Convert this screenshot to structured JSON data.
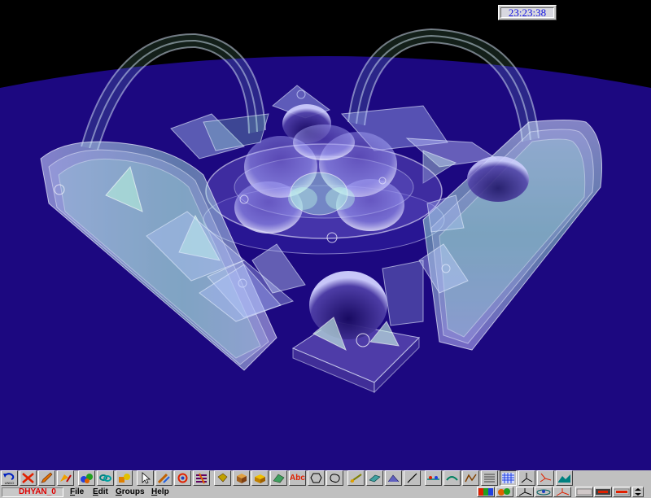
{
  "app": {
    "document_name": "DHYAN_0",
    "clock": "23:23:38"
  },
  "menu": [
    {
      "label": "File",
      "hotkey": "F",
      "rest": "ile"
    },
    {
      "label": "Edit",
      "hotkey": "E",
      "rest": "dit"
    },
    {
      "label": "Groups",
      "hotkey": "G",
      "rest": "roups"
    },
    {
      "label": "Help",
      "hotkey": "H",
      "rest": "elp"
    }
  ],
  "toolbar": {
    "undo_label": "UNDO",
    "text_tool_label": "Abc",
    "tools": [
      {
        "name": "undo-button",
        "icon": "undo-icon"
      },
      {
        "name": "delete-button",
        "icon": "cross-icon"
      },
      {
        "name": "pencil-button",
        "icon": "pencil-icon"
      },
      {
        "name": "fill-button",
        "icon": "paint-icon"
      },
      {
        "name": "spheres-button",
        "icon": "spheres-icon"
      },
      {
        "name": "link-button",
        "icon": "link-icon"
      },
      {
        "name": "shapes-button",
        "icon": "shapes-icon"
      },
      {
        "name": "select-button",
        "icon": "arrow-cursor-icon"
      },
      {
        "name": "pen-tool-button",
        "icon": "pen-icon"
      },
      {
        "name": "rotate-button",
        "icon": "rotate-icon"
      },
      {
        "name": "layers-button",
        "icon": "layers-icon"
      },
      {
        "name": "cube-button",
        "icon": "cube-icon"
      },
      {
        "name": "box-button",
        "icon": "box-icon"
      },
      {
        "name": "prism-button",
        "icon": "prism-icon"
      },
      {
        "name": "text-button",
        "icon": "text-icon"
      },
      {
        "name": "polygon-button",
        "icon": "polygon-icon"
      },
      {
        "name": "blob-button",
        "icon": "blob-icon"
      },
      {
        "name": "line-button",
        "icon": "line-icon"
      },
      {
        "name": "plane-button",
        "icon": "plane-icon"
      },
      {
        "name": "sweep-button",
        "icon": "sweep-icon"
      },
      {
        "name": "slash-button",
        "icon": "slash-icon"
      },
      {
        "name": "group-button",
        "icon": "group-icon"
      },
      {
        "name": "curve-button",
        "icon": "curve-icon"
      },
      {
        "name": "path-button",
        "icon": "path-icon"
      },
      {
        "name": "list-button",
        "icon": "list-icon"
      },
      {
        "name": "grid-button",
        "icon": "grid-icon"
      },
      {
        "name": "axes-button",
        "icon": "axes-icon"
      },
      {
        "name": "axes-tilt-button",
        "icon": "axes-tilt-icon"
      },
      {
        "name": "terrain-button",
        "icon": "terrain-icon"
      }
    ]
  },
  "colors": {
    "sky": "#000000",
    "ground": "#1c0880",
    "clock_text": "#1010e0",
    "doc_name": "#e00000",
    "glass_fill": "#b4c8ff",
    "glass_highlight": "#a0ffd0"
  }
}
